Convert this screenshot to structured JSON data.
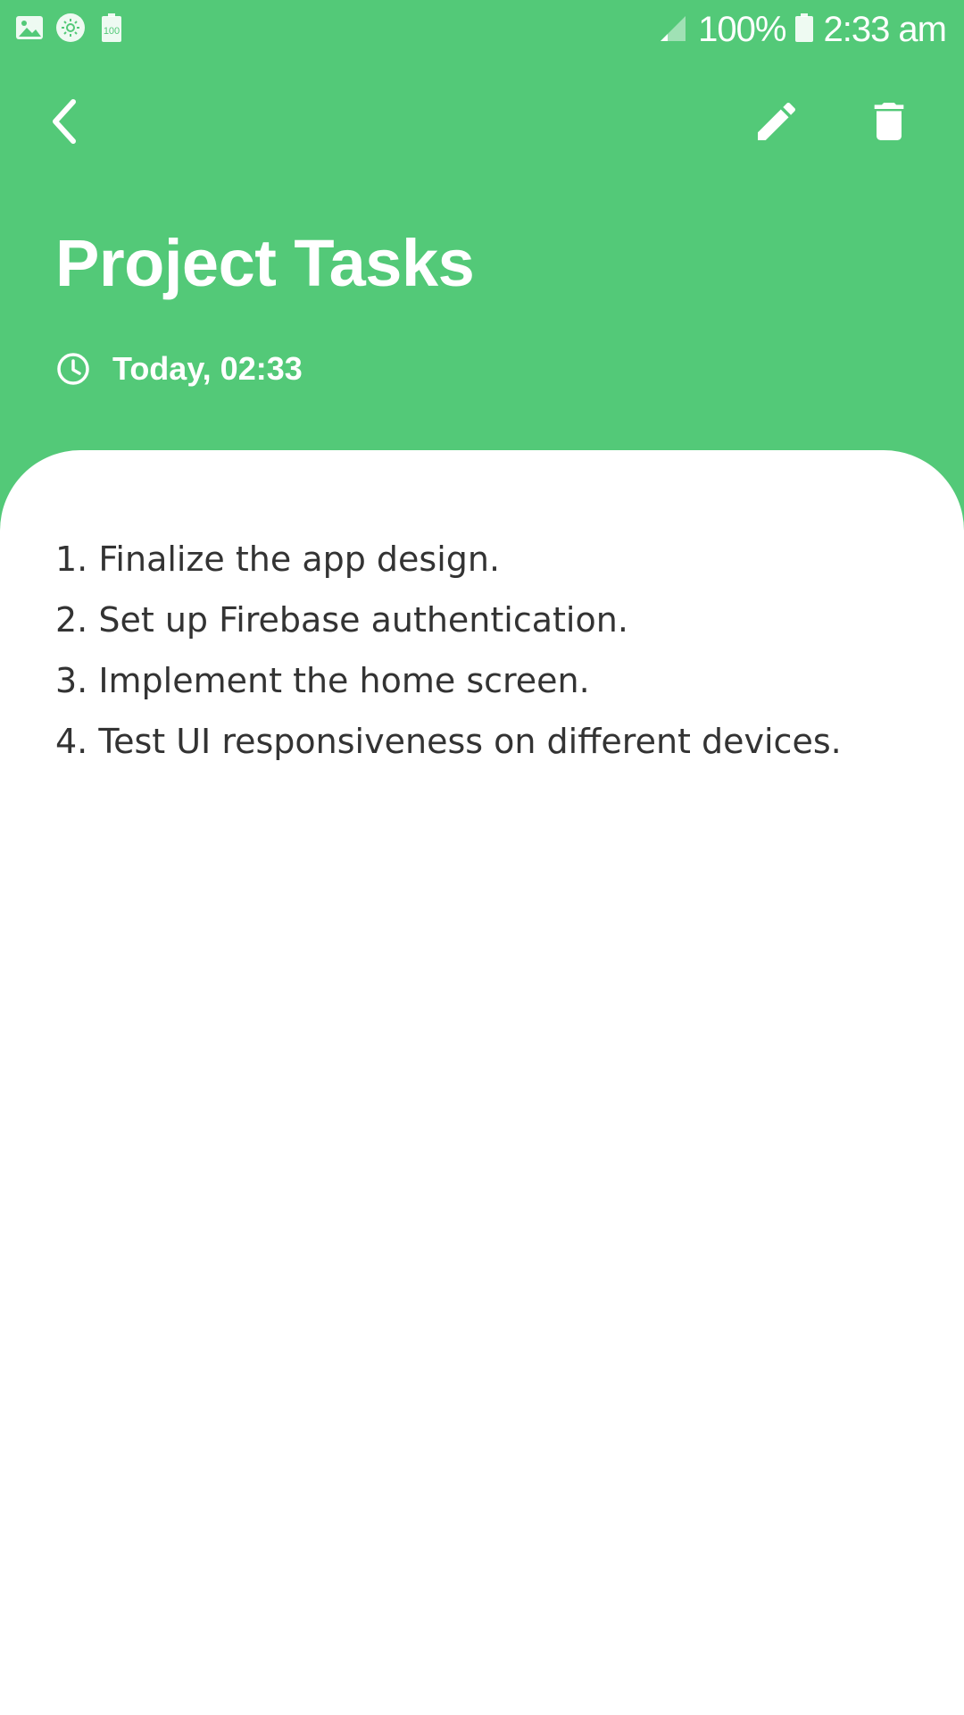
{
  "status_bar": {
    "icons_left": [
      "gallery-icon",
      "brightness-icon",
      "battery-saver-icon"
    ],
    "battery_saver_label": "100",
    "battery_percent": "100%",
    "time": "2:33 am"
  },
  "app_bar": {
    "back_icon": "chevron-left-icon",
    "edit_icon": "pencil-icon",
    "delete_icon": "trash-icon"
  },
  "note": {
    "title": "Project Tasks",
    "timestamp": "Today, 02:33",
    "items": [
      "1. Finalize the app design.",
      "2. Set up Firebase authentication.",
      "3. Implement the home screen.",
      "4. Test UI responsiveness on different devices."
    ]
  },
  "colors": {
    "accent": "#53C978",
    "surface": "#FFFFFF",
    "text": "#333333"
  }
}
